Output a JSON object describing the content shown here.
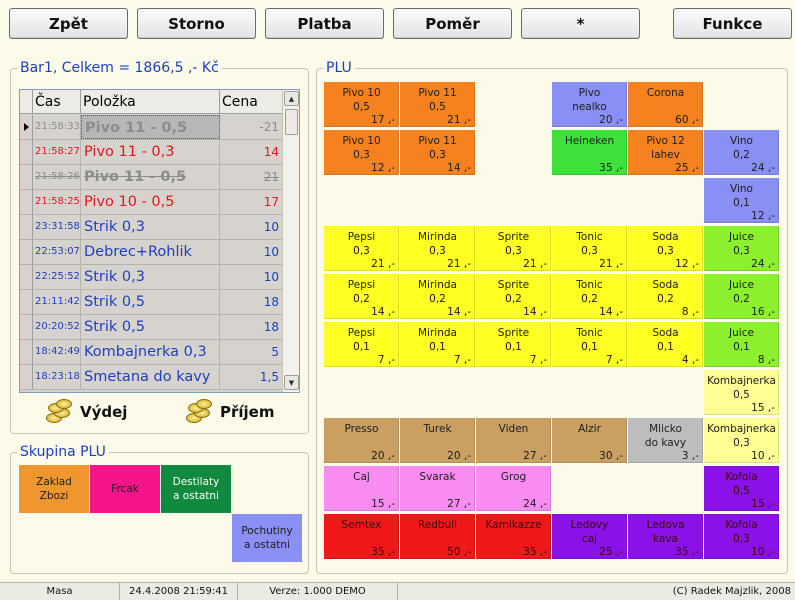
{
  "toolbar": [
    {
      "name": "back-button",
      "label": "Zpět"
    },
    {
      "name": "cancel-button",
      "label": "Storno"
    },
    {
      "name": "payment-button",
      "label": "Platba"
    },
    {
      "name": "ratio-button",
      "label": "Poměr"
    },
    {
      "name": "multiply-button",
      "label": "*"
    },
    {
      "name": "functions-button",
      "label": "Funkce"
    }
  ],
  "receipt": {
    "title": "Bar1, Celkem = 1866,5 ,- Kč",
    "columns": {
      "time": "Čas",
      "item": "Položka",
      "price": "Cena"
    },
    "rows": [
      {
        "time": "21:58:33",
        "item": "Pivo 11 - 0,5",
        "price": "-21",
        "style": "gray",
        "selected": true
      },
      {
        "time": "21:58:27",
        "item": "Pivo 11 - 0,3",
        "price": "14",
        "style": "red"
      },
      {
        "time": "21:58:26",
        "item": "Pivo 11 - 0,5",
        "price": "21",
        "style": "gray-strike"
      },
      {
        "time": "21:58:25",
        "item": "Pivo 10 - 0,5",
        "price": "17",
        "style": "red"
      },
      {
        "time": "23:31:58",
        "item": "Strik 0,3",
        "price": "10",
        "style": "blue"
      },
      {
        "time": "22:53:07",
        "item": "Debrec+Rohlik",
        "price": "10",
        "style": "blue"
      },
      {
        "time": "22:25:52",
        "item": "Strik 0,3",
        "price": "10",
        "style": "blue"
      },
      {
        "time": "21:11:42",
        "item": "Strik 0,5",
        "price": "18",
        "style": "blue"
      },
      {
        "time": "20:20:52",
        "item": "Strik 0,5",
        "price": "18",
        "style": "blue"
      },
      {
        "time": "18:42:49",
        "item": "Kombajnerka 0,3",
        "price": "5",
        "style": "blue"
      },
      {
        "time": "18:23:18",
        "item": "Smetana do kavy",
        "price": "1,5",
        "style": "blue"
      }
    ]
  },
  "actions": {
    "issue": "Výdej",
    "receive": "Příjem"
  },
  "plu_groups": {
    "title": "Skupina PLU",
    "items": [
      {
        "label": "Zaklad\nZbozi",
        "color": "#f0962e"
      },
      {
        "label": "Frcak",
        "color": "#f5148a"
      },
      {
        "label": "Destilaty\na ostatni",
        "color": "#108a3e"
      },
      {
        "label": "Pochutiny\na ostatni",
        "color": "#8a8ff5"
      }
    ]
  },
  "plu": {
    "title": "PLU",
    "tiles": [
      {
        "col": 0,
        "row": 0,
        "name": "Pivo 10\n0,5",
        "price": "17 ,-",
        "color": "#f5821f"
      },
      {
        "col": 1,
        "row": 0,
        "name": "Pivo 11\n0,5",
        "price": "21 ,-",
        "color": "#f5821f"
      },
      {
        "col": 3,
        "row": 0,
        "name": "Pivo\nnealko",
        "price": "20 ,-",
        "color": "#8a8ff5"
      },
      {
        "col": 4,
        "row": 0,
        "name": "Corona",
        "price": "60 ,-",
        "color": "#f5821f"
      },
      {
        "col": 0,
        "row": 1,
        "name": "Pivo 10\n0,3",
        "price": "12 ,-",
        "color": "#f5821f"
      },
      {
        "col": 1,
        "row": 1,
        "name": "Pivo 11\n0,3",
        "price": "14 ,-",
        "color": "#f5821f"
      },
      {
        "col": 3,
        "row": 1,
        "name": "Heineken",
        "price": "35 ,-",
        "color": "#3ee03a"
      },
      {
        "col": 4,
        "row": 1,
        "name": "Pivo 12\nlahev",
        "price": "25 ,-",
        "color": "#f5821f"
      },
      {
        "col": 5,
        "row": 1,
        "name": "Vino\n0,2",
        "price": "24 ,-",
        "color": "#8a8ff5"
      },
      {
        "col": 5,
        "row": 2,
        "name": "Vino\n0,1",
        "price": "12 ,-",
        "color": "#8a8ff5"
      },
      {
        "col": 0,
        "row": 3,
        "name": "Pepsi\n0,3",
        "price": "21 ,-",
        "color": "#ffff22"
      },
      {
        "col": 1,
        "row": 3,
        "name": "Mirinda\n0,3",
        "price": "21 ,-",
        "color": "#ffff22"
      },
      {
        "col": 2,
        "row": 3,
        "name": "Sprite\n0,3",
        "price": "21 ,-",
        "color": "#ffff22"
      },
      {
        "col": 3,
        "row": 3,
        "name": "Tonic\n0,3",
        "price": "21 ,-",
        "color": "#ffff22"
      },
      {
        "col": 4,
        "row": 3,
        "name": "Soda\n0,3",
        "price": "12 ,-",
        "color": "#ffff22"
      },
      {
        "col": 5,
        "row": 3,
        "name": "Juice\n0,3",
        "price": "24 ,-",
        "color": "#8cf02e"
      },
      {
        "col": 0,
        "row": 4,
        "name": "Pepsi\n0,2",
        "price": "14 ,-",
        "color": "#ffff22"
      },
      {
        "col": 1,
        "row": 4,
        "name": "Mirinda\n0,2",
        "price": "14 ,-",
        "color": "#ffff22"
      },
      {
        "col": 2,
        "row": 4,
        "name": "Sprite\n0,2",
        "price": "14 ,-",
        "color": "#ffff22"
      },
      {
        "col": 3,
        "row": 4,
        "name": "Tonic\n0,2",
        "price": "14 ,-",
        "color": "#ffff22"
      },
      {
        "col": 4,
        "row": 4,
        "name": "Soda\n0,2",
        "price": "8 ,-",
        "color": "#ffff22"
      },
      {
        "col": 5,
        "row": 4,
        "name": "Juice\n0,2",
        "price": "16 ,-",
        "color": "#8cf02e"
      },
      {
        "col": 0,
        "row": 5,
        "name": "Pepsi\n0,1",
        "price": "7 ,-",
        "color": "#ffff22"
      },
      {
        "col": 1,
        "row": 5,
        "name": "Mirinda\n0,1",
        "price": "7 ,-",
        "color": "#ffff22"
      },
      {
        "col": 2,
        "row": 5,
        "name": "Sprite\n0,1",
        "price": "7 ,-",
        "color": "#ffff22"
      },
      {
        "col": 3,
        "row": 5,
        "name": "Tonic\n0,1",
        "price": "7 ,-",
        "color": "#ffff22"
      },
      {
        "col": 4,
        "row": 5,
        "name": "Soda\n0,1",
        "price": "4 ,-",
        "color": "#ffff22"
      },
      {
        "col": 5,
        "row": 5,
        "name": "Juice\n0,1",
        "price": "8 ,-",
        "color": "#8cf02e"
      },
      {
        "col": 5,
        "row": 6,
        "name": "Kombajnerka\n0,5",
        "price": "15 ,-",
        "color": "#ffff96"
      },
      {
        "col": 0,
        "row": 7,
        "name": "Presso",
        "price": "20 ,-",
        "color": "#c9a062"
      },
      {
        "col": 1,
        "row": 7,
        "name": "Turek",
        "price": "20 ,-",
        "color": "#c9a062"
      },
      {
        "col": 2,
        "row": 7,
        "name": "Viden",
        "price": "27 ,-",
        "color": "#c9a062"
      },
      {
        "col": 3,
        "row": 7,
        "name": "Alzir",
        "price": "30 ,-",
        "color": "#c9a062"
      },
      {
        "col": 4,
        "row": 7,
        "name": "Mlicko\ndo kavy",
        "price": "3 ,-",
        "color": "#bdbdbd"
      },
      {
        "col": 5,
        "row": 7,
        "name": "Kombajnerka\n0,3",
        "price": "10 ,-",
        "color": "#ffff96"
      },
      {
        "col": 0,
        "row": 8,
        "name": "Caj",
        "price": "15 ,-",
        "color": "#f98cf0"
      },
      {
        "col": 1,
        "row": 8,
        "name": "Svarak",
        "price": "27 ,-",
        "color": "#f98cf0"
      },
      {
        "col": 2,
        "row": 8,
        "name": "Grog",
        "price": "24 ,-",
        "color": "#f98cf0"
      },
      {
        "col": 5,
        "row": 8,
        "name": "Kofola\n0,5",
        "price": "15 ,-",
        "color": "#8a12e8"
      },
      {
        "col": 0,
        "row": 9,
        "name": "Semtex",
        "price": "35 ,-",
        "color": "#f01818"
      },
      {
        "col": 1,
        "row": 9,
        "name": "Redbull",
        "price": "50 ,-",
        "color": "#f01818"
      },
      {
        "col": 2,
        "row": 9,
        "name": "Kamikazze",
        "price": "35 ,-",
        "color": "#f01818"
      },
      {
        "col": 3,
        "row": 9,
        "name": "Ledovy\ncaj",
        "price": "25 ,-",
        "color": "#8a12e8"
      },
      {
        "col": 4,
        "row": 9,
        "name": "Ledova\nkava",
        "price": "35 ,-",
        "color": "#8a12e8"
      },
      {
        "col": 5,
        "row": 9,
        "name": "Kofola\n0,3",
        "price": "10 ,-",
        "color": "#8a12e8"
      }
    ]
  },
  "status": {
    "location": "Masa",
    "datetime": "24.4.2008   21:59:41",
    "version": "Verze: 1.000 DEMO",
    "copyright": "(C) Radek Majzlik, 2008"
  }
}
